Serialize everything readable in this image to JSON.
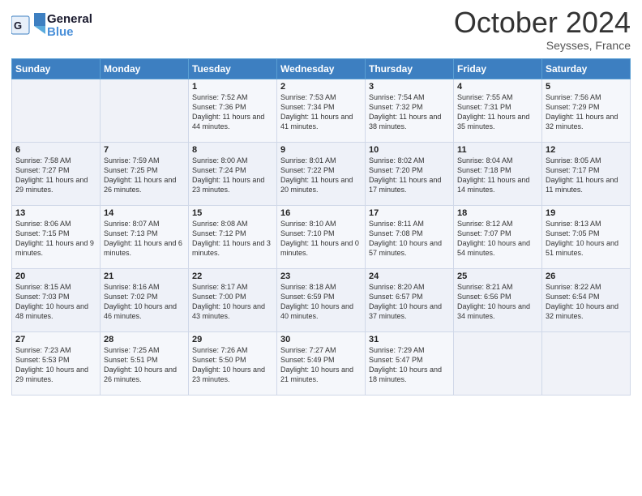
{
  "header": {
    "logo_general": "General",
    "logo_blue": "Blue",
    "month": "October 2024",
    "location": "Seysses, France"
  },
  "days_of_week": [
    "Sunday",
    "Monday",
    "Tuesday",
    "Wednesday",
    "Thursday",
    "Friday",
    "Saturday"
  ],
  "weeks": [
    [
      {
        "day": "",
        "content": ""
      },
      {
        "day": "",
        "content": ""
      },
      {
        "day": "1",
        "content": "Sunrise: 7:52 AM\nSunset: 7:36 PM\nDaylight: 11 hours and 44 minutes."
      },
      {
        "day": "2",
        "content": "Sunrise: 7:53 AM\nSunset: 7:34 PM\nDaylight: 11 hours and 41 minutes."
      },
      {
        "day": "3",
        "content": "Sunrise: 7:54 AM\nSunset: 7:32 PM\nDaylight: 11 hours and 38 minutes."
      },
      {
        "day": "4",
        "content": "Sunrise: 7:55 AM\nSunset: 7:31 PM\nDaylight: 11 hours and 35 minutes."
      },
      {
        "day": "5",
        "content": "Sunrise: 7:56 AM\nSunset: 7:29 PM\nDaylight: 11 hours and 32 minutes."
      }
    ],
    [
      {
        "day": "6",
        "content": "Sunrise: 7:58 AM\nSunset: 7:27 PM\nDaylight: 11 hours and 29 minutes."
      },
      {
        "day": "7",
        "content": "Sunrise: 7:59 AM\nSunset: 7:25 PM\nDaylight: 11 hours and 26 minutes."
      },
      {
        "day": "8",
        "content": "Sunrise: 8:00 AM\nSunset: 7:24 PM\nDaylight: 11 hours and 23 minutes."
      },
      {
        "day": "9",
        "content": "Sunrise: 8:01 AM\nSunset: 7:22 PM\nDaylight: 11 hours and 20 minutes."
      },
      {
        "day": "10",
        "content": "Sunrise: 8:02 AM\nSunset: 7:20 PM\nDaylight: 11 hours and 17 minutes."
      },
      {
        "day": "11",
        "content": "Sunrise: 8:04 AM\nSunset: 7:18 PM\nDaylight: 11 hours and 14 minutes."
      },
      {
        "day": "12",
        "content": "Sunrise: 8:05 AM\nSunset: 7:17 PM\nDaylight: 11 hours and 11 minutes."
      }
    ],
    [
      {
        "day": "13",
        "content": "Sunrise: 8:06 AM\nSunset: 7:15 PM\nDaylight: 11 hours and 9 minutes."
      },
      {
        "day": "14",
        "content": "Sunrise: 8:07 AM\nSunset: 7:13 PM\nDaylight: 11 hours and 6 minutes."
      },
      {
        "day": "15",
        "content": "Sunrise: 8:08 AM\nSunset: 7:12 PM\nDaylight: 11 hours and 3 minutes."
      },
      {
        "day": "16",
        "content": "Sunrise: 8:10 AM\nSunset: 7:10 PM\nDaylight: 11 hours and 0 minutes."
      },
      {
        "day": "17",
        "content": "Sunrise: 8:11 AM\nSunset: 7:08 PM\nDaylight: 10 hours and 57 minutes."
      },
      {
        "day": "18",
        "content": "Sunrise: 8:12 AM\nSunset: 7:07 PM\nDaylight: 10 hours and 54 minutes."
      },
      {
        "day": "19",
        "content": "Sunrise: 8:13 AM\nSunset: 7:05 PM\nDaylight: 10 hours and 51 minutes."
      }
    ],
    [
      {
        "day": "20",
        "content": "Sunrise: 8:15 AM\nSunset: 7:03 PM\nDaylight: 10 hours and 48 minutes."
      },
      {
        "day": "21",
        "content": "Sunrise: 8:16 AM\nSunset: 7:02 PM\nDaylight: 10 hours and 46 minutes."
      },
      {
        "day": "22",
        "content": "Sunrise: 8:17 AM\nSunset: 7:00 PM\nDaylight: 10 hours and 43 minutes."
      },
      {
        "day": "23",
        "content": "Sunrise: 8:18 AM\nSunset: 6:59 PM\nDaylight: 10 hours and 40 minutes."
      },
      {
        "day": "24",
        "content": "Sunrise: 8:20 AM\nSunset: 6:57 PM\nDaylight: 10 hours and 37 minutes."
      },
      {
        "day": "25",
        "content": "Sunrise: 8:21 AM\nSunset: 6:56 PM\nDaylight: 10 hours and 34 minutes."
      },
      {
        "day": "26",
        "content": "Sunrise: 8:22 AM\nSunset: 6:54 PM\nDaylight: 10 hours and 32 minutes."
      }
    ],
    [
      {
        "day": "27",
        "content": "Sunrise: 7:23 AM\nSunset: 5:53 PM\nDaylight: 10 hours and 29 minutes."
      },
      {
        "day": "28",
        "content": "Sunrise: 7:25 AM\nSunset: 5:51 PM\nDaylight: 10 hours and 26 minutes."
      },
      {
        "day": "29",
        "content": "Sunrise: 7:26 AM\nSunset: 5:50 PM\nDaylight: 10 hours and 23 minutes."
      },
      {
        "day": "30",
        "content": "Sunrise: 7:27 AM\nSunset: 5:49 PM\nDaylight: 10 hours and 21 minutes."
      },
      {
        "day": "31",
        "content": "Sunrise: 7:29 AM\nSunset: 5:47 PM\nDaylight: 10 hours and 18 minutes."
      },
      {
        "day": "",
        "content": ""
      },
      {
        "day": "",
        "content": ""
      }
    ]
  ]
}
